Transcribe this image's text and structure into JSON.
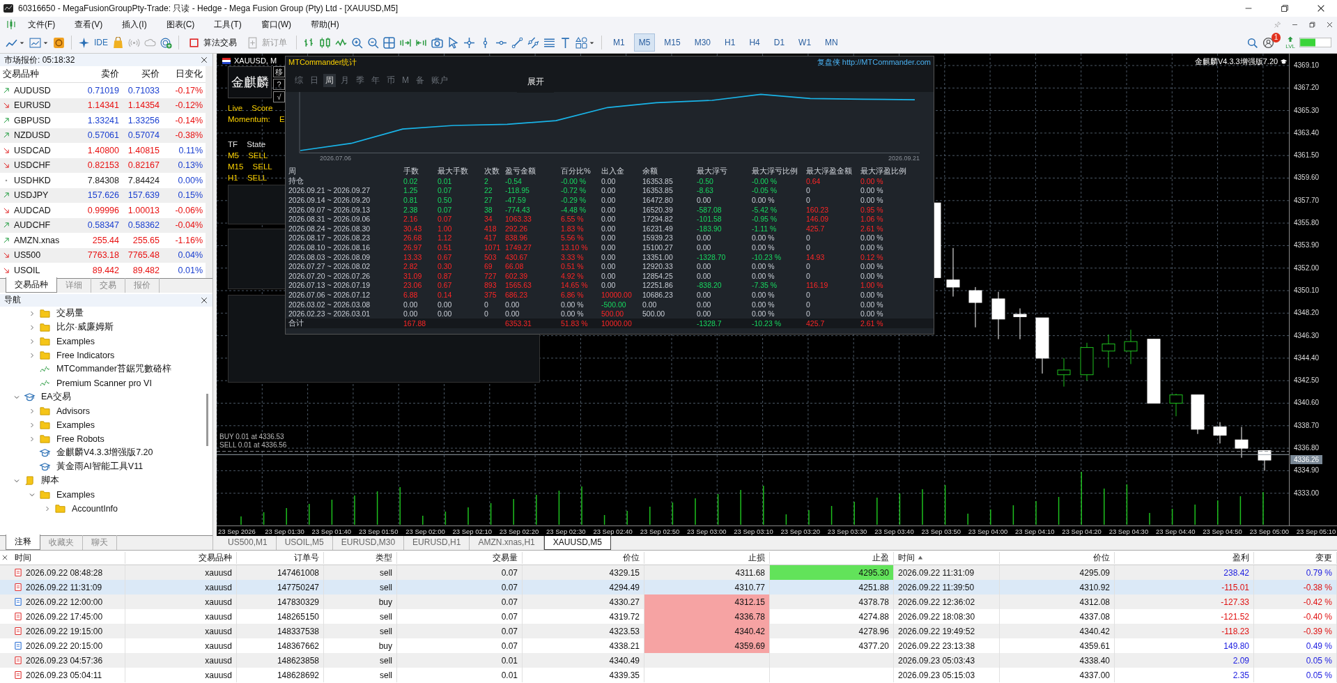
{
  "window": {
    "title": "60316650 - MegaFusionGroupPty-Trade: 只读 - Hedge - Mega Fusion Group (Pty) Ltd - [XAUUSD,M5]"
  },
  "menu": [
    "文件(F)",
    "查看(V)",
    "插入(I)",
    "图表(C)",
    "工具(T)",
    "窗口(W)",
    "帮助(H)"
  ],
  "toolbar": {
    "ide": "IDE",
    "algo_trading": "算法交易",
    "new_order": {
      "label": "新订单",
      "disabled": true
    },
    "timeframes": [
      {
        "label": "M1",
        "selected": false
      },
      {
        "label": "M5",
        "selected": true
      },
      {
        "label": "M15",
        "selected": false
      },
      {
        "label": "M30",
        "selected": false
      },
      {
        "label": "H1",
        "selected": false
      },
      {
        "label": "H4",
        "selected": false
      },
      {
        "label": "D1",
        "selected": false
      },
      {
        "label": "W1",
        "selected": false
      },
      {
        "label": "MN",
        "selected": false
      }
    ],
    "notification_count": "1",
    "level_label": "LVL"
  },
  "market_watch": {
    "title": "市场报价: 05:18:32",
    "columns": [
      "交易品种",
      "卖价",
      "买价",
      "日变化"
    ],
    "rows": [
      {
        "symbol": "AUDUSD",
        "kind": "up",
        "bid": "0.71019",
        "ask": "0.71033",
        "color": "#1a3fd0",
        "change": "-0.17%",
        "change_up": false
      },
      {
        "symbol": "EURUSD",
        "kind": "down",
        "bid": "1.14341",
        "ask": "1.14354",
        "color": "#e81010",
        "change": "-0.12%",
        "change_up": false
      },
      {
        "symbol": "GBPUSD",
        "kind": "up",
        "bid": "1.33241",
        "ask": "1.33256",
        "color": "#1a3fd0",
        "change": "-0.14%",
        "change_up": false
      },
      {
        "symbol": "NZDUSD",
        "kind": "up",
        "bid": "0.57061",
        "ask": "0.57074",
        "color": "#1a3fd0",
        "change": "-0.38%",
        "change_up": false
      },
      {
        "symbol": "USDCAD",
        "kind": "down",
        "bid": "1.40800",
        "ask": "1.40815",
        "color": "#e81010",
        "change": "0.11%",
        "change_up": true
      },
      {
        "symbol": "USDCHF",
        "kind": "down",
        "bid": "0.82153",
        "ask": "0.82167",
        "color": "#e81010",
        "change": "0.13%",
        "change_up": true
      },
      {
        "symbol": "USDHKD",
        "kind": "flat",
        "bid": "7.84308",
        "ask": "7.84424",
        "color": "#222222",
        "change": "0.00%",
        "change_up": true
      },
      {
        "symbol": "USDJPY",
        "kind": "up",
        "bid": "157.626",
        "ask": "157.639",
        "color": "#1a3fd0",
        "change": "0.15%",
        "change_up": true
      },
      {
        "symbol": "AUDCAD",
        "kind": "down",
        "bid": "0.99996",
        "ask": "1.00013",
        "color": "#e81010",
        "change": "-0.06%",
        "change_up": false
      },
      {
        "symbol": "AUDCHF",
        "kind": "up",
        "bid": "0.58347",
        "ask": "0.58362",
        "color": "#1a3fd0",
        "change": "-0.04%",
        "change_up": false
      },
      {
        "symbol": "AMZN.xnas",
        "kind": "up",
        "bid": "255.44",
        "ask": "255.65",
        "color": "#e81010",
        "change": "-1.16%",
        "change_up": false
      },
      {
        "symbol": "US500",
        "kind": "down",
        "bid": "7763.18",
        "ask": "7765.48",
        "color": "#e81010",
        "change": "0.04%",
        "change_up": true
      },
      {
        "symbol": "USOIL",
        "kind": "down",
        "bid": "89.442",
        "ask": "89.482",
        "color": "#e81010",
        "change": "0.01%",
        "change_up": true
      }
    ],
    "tabs": [
      {
        "label": "交易品种",
        "selected": true
      },
      {
        "label": "详细",
        "selected": false
      },
      {
        "label": "交易",
        "selected": false
      },
      {
        "label": "报价",
        "selected": false
      }
    ]
  },
  "navigator": {
    "title": "导航",
    "tree": [
      {
        "children": [
          {
            "label": "交易量",
            "kind": "folder",
            "expanded": false
          },
          {
            "label": "比尔·威廉姆斯",
            "kind": "folder",
            "expanded": false
          },
          {
            "label": "Examples",
            "kind": "folder",
            "expanded": false
          },
          {
            "label": "Free Indicators",
            "kind": "folder",
            "expanded": false
          },
          {
            "label": "MTCommander苔鋸咒數硌梓",
            "kind": "indicator"
          },
          {
            "label": "Premium Scanner pro VI",
            "kind": "indicator"
          }
        ]
      },
      {
        "label": "EA交易",
        "kind": "experts",
        "expanded": true,
        "children": [
          {
            "label": "Advisors",
            "kind": "folder",
            "expanded": false
          },
          {
            "label": "Examples",
            "kind": "folder",
            "expanded": false
          },
          {
            "label": "Free Robots",
            "kind": "folder",
            "expanded": false
          },
          {
            "label": "金麒麟V4.3.3增强版7.20",
            "kind": "expert"
          },
          {
            "label": "黃金雨AI智能工具V11",
            "kind": "expert"
          }
        ]
      },
      {
        "label": "脚本",
        "kind": "scripts",
        "expanded": true,
        "children": [
          {
            "label": "Examples",
            "kind": "folder",
            "expanded": true,
            "children": [
              {
                "label": "AccountInfo",
                "kind": "folder",
                "expanded": false
              }
            ]
          }
        ]
      }
    ],
    "tabs": [
      {
        "label": "注释",
        "selected": true
      },
      {
        "label": "收藏夹",
        "selected": false
      },
      {
        "label": "聊天",
        "selected": false
      }
    ]
  },
  "chart": {
    "label": "XAUUSD, M",
    "ea_name": "金麒麟V4.3.3增强版7.20",
    "price_axis": [
      "4369.10",
      "4367.20",
      "4365.30",
      "4363.40",
      "4361.50",
      "4359.60",
      "4357.70",
      "4355.80",
      "4353.90",
      "4352.00",
      "4350.10",
      "4348.20",
      "4346.30",
      "4344.40",
      "4342.50",
      "4340.60",
      "4338.70",
      "4336.80",
      "4334.90",
      "4333.00"
    ],
    "current_price": "4336.26",
    "time_axis": [
      "23 Sep 2026",
      "23 Sep 01:30",
      "23 Sep 01:40",
      "23 Sep 01:50",
      "23 Sep 02:00",
      "23 Sep 02:10",
      "23 Sep 02:20",
      "23 Sep 02:30",
      "23 Sep 02:40",
      "23 Sep 02:50",
      "23 Sep 03:00",
      "23 Sep 03:10",
      "23 Sep 03:20",
      "23 Sep 03:30",
      "23 Sep 03:40",
      "23 Sep 03:50",
      "23 Sep 04:00",
      "23 Sep 04:10",
      "23 Sep 04:20",
      "23 Sep 04:30",
      "23 Sep 04:40",
      "23 Sep 04:50",
      "23 Sep 05:00",
      "23 Sep 05:10"
    ],
    "order_labels": [
      "BUY 0.01 at 4336.53",
      "SELL 0.01 at 4336.56"
    ]
  },
  "ea_panel": {
    "title": "金麒麟",
    "side_buttons": [
      "移",
      "?",
      "√"
    ],
    "lines": [
      {
        "text": "Live Score",
        "highlighted": true
      },
      {
        "text": "Momentum: E",
        "highlighted": true
      },
      {
        "text": "TF State",
        "highlighted": false
      },
      {
        "text": "M5 SELL",
        "highlighted": true
      },
      {
        "text": "M15 SELL",
        "highlighted": true
      },
      {
        "text": "H1 SELL",
        "highlighted": true
      }
    ]
  },
  "stats": {
    "title": "MTCommander统计",
    "link": "复盘侠 http://MTCommander.com",
    "tabs": [
      {
        "label": "综",
        "selected": false
      },
      {
        "label": "日",
        "selected": false
      },
      {
        "label": "周",
        "selected": true
      },
      {
        "label": "月",
        "selected": false
      },
      {
        "label": "季",
        "selected": false
      },
      {
        "label": "年",
        "selected": false
      },
      {
        "label": "币",
        "selected": false
      },
      {
        "label": "M",
        "selected": false
      },
      {
        "label": "备",
        "selected": false
      },
      {
        "label": "账户",
        "selected": false
      }
    ],
    "expand_button": "展开",
    "equity_start": "2026.07.06",
    "equity_end": "2026.09.21",
    "columns": [
      "周",
      "手数",
      "最大手数",
      "次数",
      "盈亏金额",
      "百分比%",
      "出入金",
      "余额",
      "最大浮亏",
      "最大浮亏比例",
      "最大浮盈金额",
      "最大浮盈比例"
    ],
    "rows": [
      {
        "cells": [
          "持仓",
          "0.02",
          "0.01",
          "2",
          "-0.54",
          "-0.00 %",
          "0.00",
          "16353.85",
          "-0.50",
          "-0.00 %",
          "0.64",
          "0.00 %"
        ],
        "traded": true,
        "loss": true,
        "deposit": false,
        "withdrawal": false,
        "float_loss": true,
        "float_profit": true
      },
      {
        "cells": [
          "2026.09.21 ~ 2026.09.27",
          "1.25",
          "0.07",
          "22",
          "-118.95",
          "-0.72 %",
          "0.00",
          "16353.85",
          "-8.63",
          "-0.05 %",
          "0",
          "0.00 %"
        ],
        "traded": true,
        "loss": true,
        "deposit": false,
        "withdrawal": false,
        "float_loss": true,
        "float_profit": false
      },
      {
        "cells": [
          "2026.09.14 ~ 2026.09.20",
          "0.81",
          "0.50",
          "27",
          "-47.59",
          "-0.29 %",
          "0.00",
          "16472.80",
          "0.00",
          "0.00 %",
          "0",
          "0.00 %"
        ],
        "traded": true,
        "loss": true,
        "deposit": false,
        "withdrawal": false,
        "float_loss": false,
        "float_profit": false
      },
      {
        "cells": [
          "2026.09.07 ~ 2026.09.13",
          "2.38",
          "0.07",
          "38",
          "-774.43",
          "-4.48 %",
          "0.00",
          "16520.39",
          "-587.08",
          "-5.42 %",
          "160.23",
          "0.95 %"
        ],
        "traded": true,
        "loss": true,
        "deposit": false,
        "withdrawal": false,
        "float_loss": true,
        "float_profit": true
      },
      {
        "cells": [
          "2026.08.31 ~ 2026.09.06",
          "2.16",
          "0.07",
          "34",
          "1063.33",
          "6.55 %",
          "0.00",
          "17294.82",
          "-101.58",
          "-0.95 %",
          "146.09",
          "1.06 %"
        ],
        "traded": true,
        "loss": false,
        "deposit": false,
        "withdrawal": false,
        "float_loss": true,
        "float_profit": true
      },
      {
        "cells": [
          "2026.08.24 ~ 2026.08.30",
          "30.43",
          "1.00",
          "418",
          "292.26",
          "1.83 %",
          "0.00",
          "16231.49",
          "-183.90",
          "-1.11 %",
          "425.7",
          "2.61 %"
        ],
        "traded": true,
        "loss": false,
        "deposit": false,
        "withdrawal": false,
        "float_loss": true,
        "float_profit": true
      },
      {
        "cells": [
          "2026.08.17 ~ 2026.08.23",
          "26.68",
          "1.12",
          "417",
          "838.96",
          "5.56 %",
          "0.00",
          "15939.23",
          "0.00",
          "0.00 %",
          "0",
          "0.00 %"
        ],
        "traded": true,
        "loss": false,
        "deposit": false,
        "withdrawal": false,
        "float_loss": false,
        "float_profit": false
      },
      {
        "cells": [
          "2026.08.10 ~ 2026.08.16",
          "26.97",
          "0.51",
          "1071",
          "1749.27",
          "13.10 %",
          "0.00",
          "15100.27",
          "0.00",
          "0.00 %",
          "0",
          "0.00 %"
        ],
        "traded": true,
        "loss": false,
        "deposit": false,
        "withdrawal": false,
        "float_loss": false,
        "float_profit": false
      },
      {
        "cells": [
          "2026.08.03 ~ 2026.08.09",
          "13.33",
          "0.67",
          "503",
          "430.67",
          "3.33 %",
          "0.00",
          "13351.00",
          "-1328.70",
          "-10.23 %",
          "14.93",
          "0.12 %"
        ],
        "traded": true,
        "loss": false,
        "deposit": false,
        "withdrawal": false,
        "float_loss": true,
        "float_profit": true
      },
      {
        "cells": [
          "2026.07.27 ~ 2026.08.02",
          "2.82",
          "0.30",
          "69",
          "66.08",
          "0.51 %",
          "0.00",
          "12920.33",
          "0.00",
          "0.00 %",
          "0",
          "0.00 %"
        ],
        "traded": true,
        "loss": false,
        "deposit": false,
        "withdrawal": false,
        "float_loss": false,
        "float_profit": false
      },
      {
        "cells": [
          "2026.07.20 ~ 2026.07.26",
          "31.09",
          "0.87",
          "727",
          "602.39",
          "4.92 %",
          "0.00",
          "12854.25",
          "0.00",
          "0.00 %",
          "0",
          "0.00 %"
        ],
        "traded": true,
        "loss": false,
        "deposit": false,
        "withdrawal": false,
        "float_loss": false,
        "float_profit": false
      },
      {
        "cells": [
          "2026.07.13 ~ 2026.07.19",
          "23.06",
          "0.67",
          "893",
          "1565.63",
          "14.65 %",
          "0.00",
          "12251.86",
          "-838.20",
          "-7.35 %",
          "116.19",
          "1.00 %"
        ],
        "traded": true,
        "loss": false,
        "deposit": false,
        "withdrawal": false,
        "float_loss": true,
        "float_profit": true
      },
      {
        "cells": [
          "2026.07.06 ~ 2026.07.12",
          "6.88",
          "0.14",
          "375",
          "686.23",
          "6.86 %",
          "10000.00",
          "10686.23",
          "0.00",
          "0.00 %",
          "0",
          "0.00 %"
        ],
        "traded": true,
        "loss": false,
        "deposit": true,
        "withdrawal": false,
        "float_loss": false,
        "float_profit": false
      },
      {
        "cells": [
          "2026.03.02 ~ 2026.03.08",
          "0.00",
          "0.00",
          "0",
          "0.00",
          "0.00 %",
          "-500.00",
          "0.00",
          "0.00",
          "0.00 %",
          "0",
          "0.00 %"
        ],
        "traded": false,
        "loss": false,
        "deposit": false,
        "withdrawal": true,
        "float_loss": false,
        "float_profit": false
      },
      {
        "cells": [
          "2026.02.23 ~ 2026.03.01",
          "0.00",
          "0.00",
          "0",
          "0.00",
          "0.00 %",
          "500.00",
          "500.00",
          "0.00",
          "0.00 %",
          "0",
          "0.00 %"
        ],
        "traded": false,
        "loss": false,
        "deposit": true,
        "withdrawal": false,
        "float_loss": false,
        "float_profit": false
      }
    ],
    "total": {
      "cells": [
        "合计",
        "167.88",
        null,
        null,
        "6353.31",
        "51.83 %",
        "10000.00",
        null,
        "-1328.7",
        "-10.23 %",
        "425.7",
        "2.61 %"
      ],
      "traded": true,
      "loss": false,
      "deposit": true,
      "withdrawal": false,
      "float_loss": true,
      "float_profit": true
    }
  },
  "chart_tabs": [
    {
      "label": "US500,M1",
      "selected": false
    },
    {
      "label": "USOIL,M5",
      "selected": false
    },
    {
      "label": "EURUSD,M30",
      "selected": false
    },
    {
      "label": "EURUSD,H1",
      "selected": false
    },
    {
      "label": "AMZN.xnas,H1",
      "selected": false
    },
    {
      "label": "XAUUSD,M5",
      "selected": true
    }
  ],
  "trades": {
    "columns": [
      {
        "label": "时间",
        "sorted": false
      },
      {
        "label": "交易品种",
        "sorted": false
      },
      {
        "label": "订单号",
        "sorted": false
      },
      {
        "label": "类型",
        "sorted": false
      },
      {
        "label": "交易量",
        "sorted": false
      },
      {
        "label": "价位",
        "sorted": false
      },
      {
        "label": "止损",
        "sorted": false
      },
      {
        "label": "止盈",
        "sorted": false
      },
      {
        "label": "时间",
        "sorted": true
      },
      {
        "label": "价位",
        "sorted": false
      },
      {
        "label": "盈利",
        "sorted": false
      },
      {
        "label": "变更",
        "sorted": false
      }
    ],
    "rows": [
      {
        "kind": "sell",
        "selected": false,
        "sl_hit": false,
        "tp_hit": true,
        "profit_up": true,
        "cells": [
          "2026.09.22 08:48:28",
          "xauusd",
          "147461008",
          "sell",
          "0.07",
          "4329.15",
          "4311.68",
          "4295.30",
          "2026.09.22 11:31:09",
          "4295.09",
          "238.42",
          "0.79 %"
        ]
      },
      {
        "kind": "sell",
        "selected": true,
        "sl_hit": false,
        "tp_hit": false,
        "profit_up": false,
        "cells": [
          "2026.09.22 11:31:09",
          "xauusd",
          "147750247",
          "sell",
          "0.07",
          "4294.49",
          "4310.77",
          "4251.88",
          "2026.09.22 11:39:50",
          "4310.92",
          "-115.01",
          "-0.38 %"
        ]
      },
      {
        "kind": "buy",
        "selected": false,
        "sl_hit": true,
        "tp_hit": false,
        "profit_up": false,
        "cells": [
          "2026.09.22 12:00:00",
          "xauusd",
          "147830329",
          "buy",
          "0.07",
          "4330.27",
          "4312.15",
          "4378.78",
          "2026.09.22 12:36:02",
          "4312.08",
          "-127.33",
          "-0.42 %"
        ]
      },
      {
        "kind": "sell",
        "selected": false,
        "sl_hit": true,
        "tp_hit": false,
        "profit_up": false,
        "cells": [
          "2026.09.22 17:45:00",
          "xauusd",
          "148265150",
          "sell",
          "0.07",
          "4319.72",
          "4336.78",
          "4274.88",
          "2026.09.22 18:08:30",
          "4337.08",
          "-121.52",
          "-0.40 %"
        ]
      },
      {
        "kind": "sell",
        "selected": false,
        "sl_hit": true,
        "tp_hit": false,
        "profit_up": false,
        "cells": [
          "2026.09.22 19:15:00",
          "xauusd",
          "148337538",
          "sell",
          "0.07",
          "4323.53",
          "4340.42",
          "4278.96",
          "2026.09.22 19:49:52",
          "4340.42",
          "-118.23",
          "-0.39 %"
        ]
      },
      {
        "kind": "buy",
        "selected": false,
        "sl_hit": true,
        "tp_hit": false,
        "profit_up": true,
        "cells": [
          "2026.09.22 20:15:00",
          "xauusd",
          "148367662",
          "buy",
          "0.07",
          "4338.21",
          "4359.69",
          "4377.20",
          "2026.09.22 23:13:38",
          "4359.61",
          "149.80",
          "0.49 %"
        ]
      },
      {
        "kind": "sell",
        "selected": false,
        "sl_hit": false,
        "tp_hit": false,
        "profit_up": true,
        "cells": [
          "2026.09.23 04:57:36",
          "xauusd",
          "148623858",
          "sell",
          "0.01",
          "4340.49",
          null,
          null,
          "2026.09.23 05:03:43",
          "4338.40",
          "2.09",
          "0.05 %"
        ]
      },
      {
        "kind": "sell",
        "selected": false,
        "sl_hit": false,
        "tp_hit": false,
        "profit_up": true,
        "cells": [
          "2026.09.23 05:04:11",
          "xauusd",
          "148628692",
          "sell",
          "0.01",
          "4339.35",
          null,
          null,
          "2026.09.23 05:15:03",
          "4337.00",
          "2.35",
          "0.05 %"
        ]
      }
    ]
  }
}
